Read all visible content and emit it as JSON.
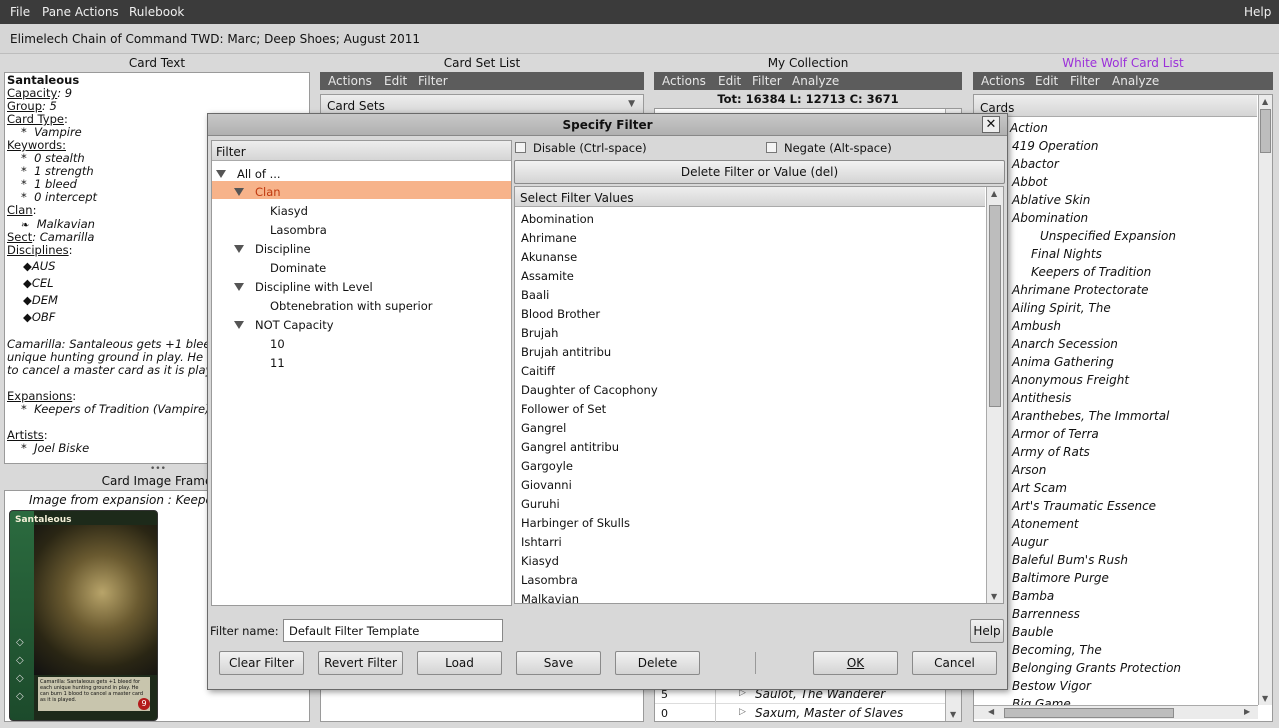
{
  "menubar": {
    "file": "File",
    "pane_actions": "Pane Actions",
    "rulebook": "Rulebook",
    "help": "Help"
  },
  "window_title": "Elimelech Chain of Command   TWD: Marc; Deep Shoes; August 2011",
  "panes": {
    "card_text": "Card Text",
    "card_set_list": "Card Set List",
    "my_collection": "My Collection",
    "ww_card_list": "White Wolf Card List",
    "card_image_frame": "Card Image Frame"
  },
  "card_set_bar": {
    "actions": "Actions",
    "edit": "Edit",
    "filter": "Filter"
  },
  "collection_bar": {
    "actions": "Actions",
    "edit": "Edit",
    "filter": "Filter",
    "analyze": "Analyze"
  },
  "ww_bar": {
    "actions": "Actions",
    "edit": "Edit",
    "filter": "Filter",
    "analyze": "Analyze"
  },
  "card_sets_header": "Card Sets",
  "collection_totals": "Tot:  16384  L:  12713  C:  3671",
  "collection_rows": [
    {
      "count": "5",
      "name": "Saulot, The Wanderer"
    },
    {
      "count": "0",
      "name": "Saxum, Master of Slaves"
    }
  ],
  "card": {
    "name": "Santaleous",
    "capacity_label": "Capacity",
    "capacity": ": 9",
    "group_label": "Group",
    "group": ": 5",
    "type_label": "Card Type",
    "type": "Vampire",
    "keywords_label": "Keywords:",
    "keywords": [
      "0 stealth",
      "1 strength",
      "1 bleed",
      "0 intercept"
    ],
    "clan_label": "Clan",
    "clan": "Malkavian",
    "sect_label": "Sect",
    "sect": ": Camarilla",
    "disciplines_label": "Disciplines",
    "disciplines": [
      "AUS",
      "CEL",
      "DEM",
      "OBF"
    ],
    "text": [
      "Camarilla: Santaleous gets +1 blee",
      "unique hunting ground in play. He m",
      "to cancel a master card as it is play"
    ],
    "expansions_label": "Expansions",
    "expansion": "Keepers of Tradition (Vampire)",
    "artists_label": "Artists",
    "artist": "Joel Biske"
  },
  "image_from_expansion": "Image from expansion :  Keepe",
  "card_image": {
    "title": "Santaleous",
    "text": "Camarilla: Santaleous gets +1 bleed for each unique hunting ground in play. He can burn 1 blood to cancel a master card as it is played."
  },
  "ww_list": {
    "header": "Cards",
    "items": [
      "Action",
      "419 Operation",
      "Abactor",
      "Abbot",
      "Ablative Skin",
      "Abomination",
      "Unspecified Expansion",
      "Final Nights",
      "Keepers of Tradition",
      "Ahrimane Protectorate",
      "Ailing Spirit, The",
      "Ambush",
      "Anarch Secession",
      "Anima Gathering",
      "Anonymous Freight",
      "Antithesis",
      "Aranthebes, The Immortal",
      "Armor of Terra",
      "Army of Rats",
      "Arson",
      "Art Scam",
      "Art's Traumatic Essence",
      "Atonement",
      "Augur",
      "Baleful Bum's Rush",
      "Baltimore Purge",
      "Bamba",
      "Barrenness",
      "Bauble",
      "Becoming, The",
      "Belonging Grants Protection",
      "Bestow Vigor",
      "Big Game"
    ]
  },
  "dialog": {
    "title": "Specify Filter",
    "filter_header": "Filter",
    "tree": [
      {
        "label": "All of ...",
        "expanded": true
      },
      {
        "label": "Clan",
        "expanded": true,
        "selected": true
      },
      {
        "label": "Kiasyd"
      },
      {
        "label": "Lasombra"
      },
      {
        "label": "Discipline",
        "expanded": true
      },
      {
        "label": "Dominate"
      },
      {
        "label": "Discipline with Level",
        "expanded": true
      },
      {
        "label": "Obtenebration with superior"
      },
      {
        "label": "NOT Capacity",
        "expanded": true
      },
      {
        "label": "10"
      },
      {
        "label": "11"
      }
    ],
    "disable_label": "Disable (Ctrl-space)",
    "negate_label": "Negate (Alt-space)",
    "delete_button": "Delete Filter or Value (del)",
    "values_header": "Select Filter Values",
    "values": [
      "Abomination",
      "Ahrimane",
      "Akunanse",
      "Assamite",
      "Baali",
      "Blood Brother",
      "Brujah",
      "Brujah antitribu",
      "Caitiff",
      "Daughter of Cacophony",
      "Follower of Set",
      "Gangrel",
      "Gangrel antitribu",
      "Gargoyle",
      "Giovanni",
      "Guruhi",
      "Harbinger of Skulls",
      "Ishtarri",
      "Kiasyd",
      "Lasombra",
      "Malkavian"
    ],
    "filter_name_label": "Filter name:",
    "filter_name_value": "Default Filter Template",
    "help": "Help",
    "clear": "Clear Filter",
    "revert": "Revert Filter",
    "load": "Load",
    "save": "Save",
    "delete": "Delete",
    "ok": "OK",
    "cancel": "Cancel"
  },
  "colors": {
    "accent_purple": "#9b30d9",
    "selection_orange": "#f7b38a"
  }
}
